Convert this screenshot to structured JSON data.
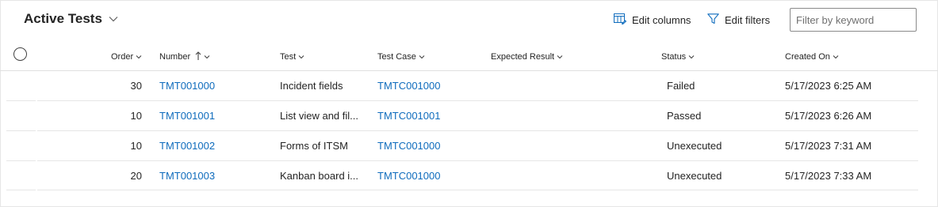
{
  "header": {
    "title": "Active Tests",
    "edit_columns_label": "Edit columns",
    "edit_filters_label": "Edit filters",
    "search_placeholder": "Filter by keyword"
  },
  "columns": {
    "order": "Order",
    "number": "Number",
    "test": "Test",
    "test_case": "Test Case",
    "expected_result": "Expected Result",
    "status": "Status",
    "created_on": "Created On"
  },
  "rows": [
    {
      "order": "30",
      "number": "TMT001000",
      "test": "Incident fields",
      "test_case": "TMTC001000",
      "expected_result": "",
      "status": "Failed",
      "created_on": "5/17/2023 6:25 AM"
    },
    {
      "order": "10",
      "number": "TMT001001",
      "test": "List view and fil...",
      "test_case": "TMTC001001",
      "expected_result": "",
      "status": "Passed",
      "created_on": "5/17/2023 6:26 AM"
    },
    {
      "order": "10",
      "number": "TMT001002",
      "test": "Forms of ITSM",
      "test_case": "TMTC001000",
      "expected_result": "",
      "status": "Unexecuted",
      "created_on": "5/17/2023 7:31 AM"
    },
    {
      "order": "20",
      "number": "TMT001003",
      "test": "Kanban board i...",
      "test_case": "TMTC001000",
      "expected_result": "",
      "status": "Unexecuted",
      "created_on": "5/17/2023 7:33 AM"
    }
  ],
  "sort": {
    "column": "number",
    "direction": "ascending"
  },
  "icons": {
    "title_dropdown": "chevron-down-icon",
    "edit_columns": "edit-columns-icon",
    "edit_filters": "filter-icon",
    "select_all": "select-all-circle-icon",
    "column_menu": "chevron-down-icon",
    "sort": "sort-ascending-arrow-icon"
  },
  "colors": {
    "link": "#0f6cbd",
    "text": "#242424",
    "divider": "#e6e6e6"
  }
}
